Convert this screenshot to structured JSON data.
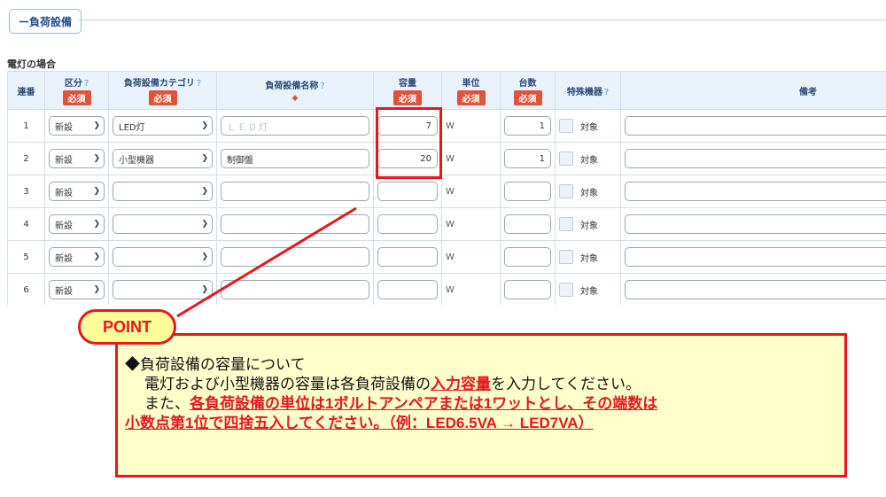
{
  "section": {
    "tab_label": "ー負荷設備"
  },
  "table_caption": "電灯の場合",
  "columns": {
    "no": "連番",
    "kubun": "区分",
    "category": "負荷設備カテゴリ",
    "name": "負荷設備名称",
    "capacity": "容量",
    "unit": "単位",
    "count": "台数",
    "special": "特殊機器",
    "note": "備考",
    "required": "必須",
    "help": "?",
    "mark": "◆"
  },
  "rows": [
    {
      "no": "1",
      "kubun": "新設",
      "category": "LED灯",
      "name": "",
      "name_placeholder": "ＬＥＤ灯",
      "capacity": "7",
      "unit": "W",
      "count": "1",
      "special_label": "対象"
    },
    {
      "no": "2",
      "kubun": "新設",
      "category": "小型機器",
      "name": "制御盤",
      "name_placeholder": "",
      "capacity": "20",
      "unit": "W",
      "count": "1",
      "special_label": "対象"
    },
    {
      "no": "3",
      "kubun": "新設",
      "category": "",
      "name": "",
      "name_placeholder": "",
      "capacity": "",
      "unit": "W",
      "count": "",
      "special_label": "対象"
    },
    {
      "no": "4",
      "kubun": "新設",
      "category": "",
      "name": "",
      "name_placeholder": "",
      "capacity": "",
      "unit": "W",
      "count": "",
      "special_label": "対象"
    },
    {
      "no": "5",
      "kubun": "新設",
      "category": "",
      "name": "",
      "name_placeholder": "",
      "capacity": "",
      "unit": "W",
      "count": "",
      "special_label": "対象"
    },
    {
      "no": "6",
      "kubun": "新設",
      "category": "",
      "name": "",
      "name_placeholder": "",
      "capacity": "",
      "unit": "W",
      "count": "",
      "special_label": "対象"
    }
  ],
  "point": {
    "badge": "POINT",
    "heading": "◆負荷設備の容量について",
    "line2_a": "電灯および小型機器の容量は各負荷設備の",
    "line2_em": "入力容量",
    "line2_b": "を入力してください。",
    "line3_a": "また、",
    "line3_em": "各負荷設備の単位は1ボルトアンペアまたは1ワットとし、その端数は",
    "line4_em": "小数点第1位で四捨五入してください。（例：LED6.5VA → LED7VA）"
  },
  "colors": {
    "accent_red": "#e8171c",
    "note_bg": "#ffffcc",
    "header_bg": "#e9f1fb"
  }
}
